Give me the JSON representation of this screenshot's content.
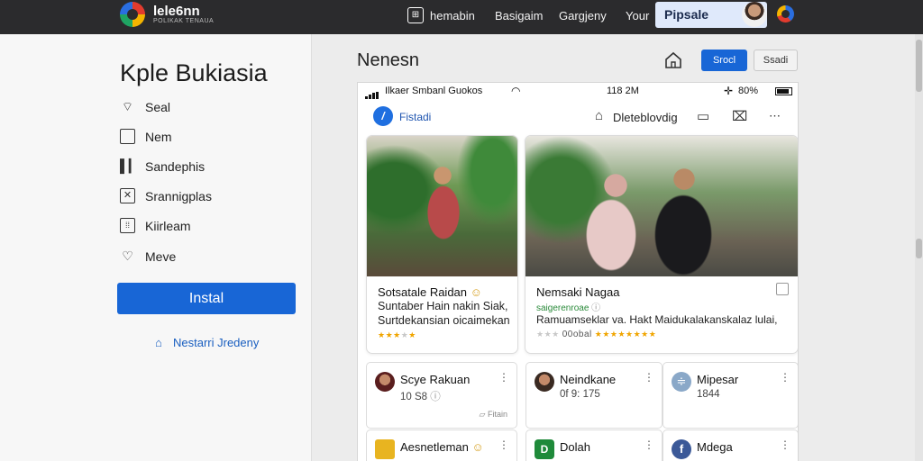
{
  "topbar": {
    "logo_title": "lele6nn",
    "logo_sub": "POLIKAK TENAUA",
    "nav_items": [
      "hemabin",
      "Basigaim",
      "Gargjeny",
      "Your"
    ],
    "search_label": "Pipsale"
  },
  "left": {
    "title": "Kple Bukiasia",
    "menu": [
      {
        "label": "Seal",
        "icon": "tag-icon"
      },
      {
        "label": "Nem",
        "icon": "square-icon"
      },
      {
        "label": "Sandephis",
        "icon": "bar-chart-icon"
      },
      {
        "label": "Srannigplas",
        "icon": "close-box-icon"
      },
      {
        "label": "Kiirleam",
        "icon": "calculator-icon"
      },
      {
        "label": "Meve",
        "icon": "heart-icon"
      }
    ],
    "install_label": "Instal",
    "link_label": "Nestarri Jredeny"
  },
  "main": {
    "title": "Nenesn",
    "primary_btn": "Srocl",
    "secondary_btn": "Ssadi"
  },
  "phone": {
    "carrier": "Ilkaer Smbanl Guokos",
    "time": "118 2M",
    "battery": "80%",
    "toolbar_label": "Fistadi",
    "toolbar_title": "Dleteblovdig",
    "cards": [
      {
        "title": "Sotsatale Raidan",
        "lines": [
          "Suntaber Hain nakin Siak,",
          "Surtdekansian oicaimekan"
        ],
        "rating": 3
      },
      {
        "title": "Nemsaki Nagaa",
        "sub": "saigerenroae",
        "lines": [
          "Ramuamseklar va. Hakt Maidukalakanskalaz lulai,"
        ],
        "rating_label": "00obal",
        "rating": 8
      }
    ],
    "list": [
      {
        "title": "Scye Rakuan",
        "sub": "10 S8",
        "foot": "Fitain"
      },
      {
        "title": "Neindkane",
        "sub": "0f 9: 175",
        "foot": ""
      },
      {
        "title": "Mipesar",
        "sub": "1844",
        "foot": ""
      },
      {
        "title": "Aesnetleman",
        "sub": "",
        "foot": ""
      },
      {
        "title": "Dolah",
        "sub": "",
        "foot": ""
      },
      {
        "title": "Mdega",
        "sub": "",
        "foot": ""
      }
    ]
  },
  "colors": {
    "accent": "#1866d6",
    "topbar": "#2b2b2d",
    "star": "#f0a500"
  }
}
